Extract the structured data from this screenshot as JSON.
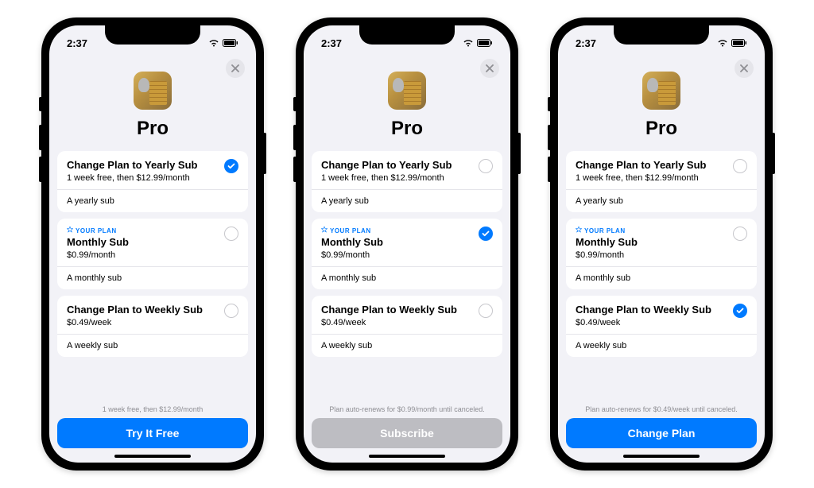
{
  "status": {
    "time": "2:37"
  },
  "header": {
    "title": "Pro"
  },
  "plans": {
    "yearly": {
      "title": "Change Plan to Yearly Sub",
      "price": "1 week free, then $12.99/month",
      "desc": "A yearly sub"
    },
    "monthly": {
      "badge": "YOUR PLAN",
      "title": "Monthly Sub",
      "price": "$0.99/month",
      "desc": "A monthly sub"
    },
    "weekly": {
      "title": "Change Plan to Weekly Sub",
      "price": "$0.49/week",
      "desc": "A weekly sub"
    }
  },
  "screens": [
    {
      "selected": "yearly",
      "footer_note": "1 week free, then $12.99/month",
      "cta_label": "Try It Free",
      "cta_style": "blue"
    },
    {
      "selected": "monthly",
      "footer_note": "Plan auto-renews for $0.99/month until canceled.",
      "cta_label": "Subscribe",
      "cta_style": "gray"
    },
    {
      "selected": "weekly",
      "footer_note": "Plan auto-renews for $0.49/week until canceled.",
      "cta_label": "Change Plan",
      "cta_style": "blue"
    }
  ]
}
